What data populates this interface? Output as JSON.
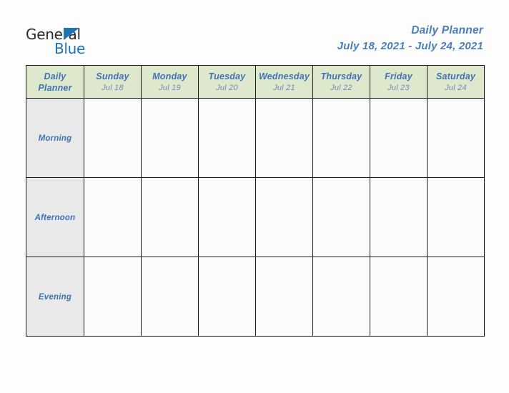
{
  "brand": {
    "name_part1": "General",
    "name_part2": "Blue",
    "triangle_icon": "triangle-icon",
    "accent_color": "#1d72b8"
  },
  "header": {
    "title": "Daily Planner",
    "date_range": "July 18, 2021 - July 24, 2021",
    "title_color": "#4a7ebb"
  },
  "table": {
    "corner": {
      "line1": "Daily",
      "line2": "Planner"
    },
    "header_bg": "#dde8cd",
    "row_label_bg": "#e9e9e9",
    "cell_bg": "#fcfcfd",
    "border_color": "#1a1a1a",
    "columns": [
      {
        "day": "Sunday",
        "date": "Jul 18"
      },
      {
        "day": "Monday",
        "date": "Jul 19"
      },
      {
        "day": "Tuesday",
        "date": "Jul 20"
      },
      {
        "day": "Wednesday",
        "date": "Jul 21"
      },
      {
        "day": "Thursday",
        "date": "Jul 22"
      },
      {
        "day": "Friday",
        "date": "Jul 23"
      },
      {
        "day": "Saturday",
        "date": "Jul 24"
      }
    ],
    "rows": [
      {
        "label": "Morning",
        "cells": [
          "",
          "",
          "",
          "",
          "",
          "",
          ""
        ]
      },
      {
        "label": "Afternoon",
        "cells": [
          "",
          "",
          "",
          "",
          "",
          "",
          ""
        ]
      },
      {
        "label": "Evening",
        "cells": [
          "",
          "",
          "",
          "",
          "",
          "",
          ""
        ]
      }
    ]
  }
}
